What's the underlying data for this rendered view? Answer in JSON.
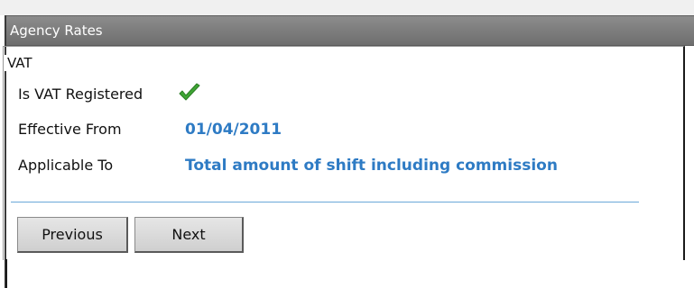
{
  "window": {
    "title": "Agency Rates"
  },
  "vat_section": {
    "legend": "VAT",
    "rows": [
      {
        "label": "Is VAT Registered",
        "value": "",
        "icon": "green-checkmark-icon"
      },
      {
        "label": "Effective From",
        "value": "01/04/2011"
      },
      {
        "label": "Applicable To",
        "value": "Total amount of shift including commission"
      }
    ]
  },
  "buttons": {
    "previous_label": "Previous",
    "next_label": "Next"
  },
  "colors": {
    "title_bar": "#7b7b7b",
    "value_text": "#2e7bc4",
    "checkmark": "#3fa535",
    "separator": "#6aa8d8"
  }
}
